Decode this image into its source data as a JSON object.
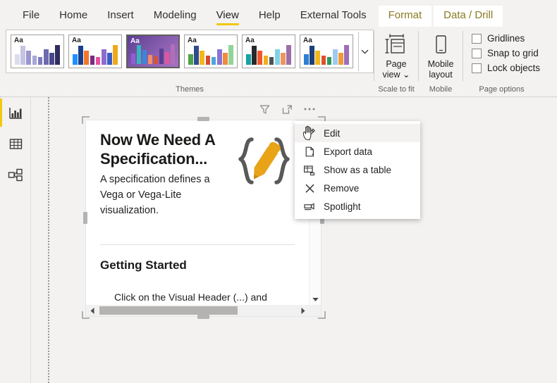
{
  "ribbon": {
    "tabs": [
      {
        "label": "File",
        "active": false,
        "contextual": false
      },
      {
        "label": "Home",
        "active": false,
        "contextual": false
      },
      {
        "label": "Insert",
        "active": false,
        "contextual": false
      },
      {
        "label": "Modeling",
        "active": false,
        "contextual": false
      },
      {
        "label": "View",
        "active": true,
        "contextual": false
      },
      {
        "label": "Help",
        "active": false,
        "contextual": false
      },
      {
        "label": "External Tools",
        "active": false,
        "contextual": false
      },
      {
        "label": "Format",
        "active": false,
        "contextual": true
      },
      {
        "label": "Data / Drill",
        "active": false,
        "contextual": true
      }
    ],
    "active_tab_accent": "#f2c811",
    "contextual_tab_color": "#8a7b20",
    "groups": {
      "themes": {
        "label": "Themes",
        "more_icon": "chevron-down-icon",
        "thumbs": [
          {
            "name": "theme-default",
            "aa": "Aa",
            "selected": false,
            "background": "#ffffff",
            "aa_color": "#201f1e",
            "bars": [
              "#dcdcee",
              "#c6c4e2",
              "#9a97cf",
              "#a9a7d8",
              "#7e7bbd",
              "#6d6ab0",
              "#4a4789",
              "#2f2d5e"
            ]
          },
          {
            "name": "theme-colorful",
            "aa": "Aa",
            "selected": false,
            "background": "#ffffff",
            "aa_color": "#201f1e",
            "bars": [
              "#1e90ff",
              "#1b3f8b",
              "#f4762a",
              "#7a2a86",
              "#e8509a",
              "#8f6bd0",
              "#3a5fc4",
              "#efa81c"
            ]
          },
          {
            "name": "theme-innovate",
            "aa": "Aa",
            "selected": true,
            "background": "linear-gradient(135deg,#5b3f94 0%,#8a5fb0 55%,#a871c2 100%)",
            "aa_color": "#ffffff",
            "bars": [
              "#8f5fd0",
              "#35b5c0",
              "#3a86d8",
              "#f08f6a",
              "#d2543c",
              "#5b3f94",
              "#e0559b",
              "#b06fb8"
            ]
          },
          {
            "name": "theme-bloom",
            "aa": "Aa",
            "selected": false,
            "background": "#ffffff",
            "aa_color": "#201f1e",
            "bars": [
              "#4ea24a",
              "#2f4b8f",
              "#f0b71e",
              "#d44a32",
              "#4fa4e0",
              "#8a73d6",
              "#f08a3c",
              "#92d39a"
            ]
          },
          {
            "name": "theme-tidal",
            "aa": "Aa",
            "selected": false,
            "background": "#ffffff",
            "aa_color": "#201f1e",
            "bars": [
              "#16a3a3",
              "#262a2e",
              "#f0562c",
              "#efb01c",
              "#4d5359",
              "#7fd3e8",
              "#f0955a",
              "#9c6fa8"
            ]
          },
          {
            "name": "theme-executive",
            "aa": "Aa",
            "selected": false,
            "background": "#ffffff",
            "aa_color": "#201f1e",
            "bars": [
              "#2b7fd4",
              "#1c3f7a",
              "#f0b71e",
              "#e0502c",
              "#2d9a5c",
              "#9fc9ef",
              "#f09a3c",
              "#9c6fb8"
            ]
          }
        ]
      },
      "scale_to_fit": {
        "label": "Scale to fit",
        "button": {
          "name": "page-view-button",
          "line1": "Page",
          "line2": "view",
          "icon": "page-view-icon",
          "has_chevron": true
        }
      },
      "mobile": {
        "label": "Mobile",
        "button": {
          "name": "mobile-layout-button",
          "line1": "Mobile",
          "line2": "layout",
          "icon": "phone-icon"
        }
      },
      "page_options": {
        "label": "Page options",
        "checks": [
          {
            "label": "Gridlines",
            "checked": false
          },
          {
            "label": "Snap to grid",
            "checked": false
          },
          {
            "label": "Lock objects",
            "checked": false
          }
        ]
      }
    }
  },
  "sidebar": {
    "items": [
      {
        "name": "report-view",
        "icon": "bar-chart-icon",
        "active": true
      },
      {
        "name": "data-view",
        "icon": "table-icon",
        "active": false
      },
      {
        "name": "model-view",
        "icon": "model-relationships-icon",
        "active": false
      }
    ]
  },
  "visual_header": {
    "icons": [
      {
        "name": "filter-icon",
        "label": "Filters"
      },
      {
        "name": "focus-mode-icon",
        "label": "Focus mode"
      },
      {
        "name": "more-options-icon",
        "label": "More options"
      }
    ]
  },
  "visual": {
    "title": "Now We Need A Specification...",
    "subtitle": "A specification defines a Vega or Vega-Lite visualization.",
    "section_heading": "Getting Started",
    "body": "Click on the Visual Header (...) and choose ‘Edit’ to display the Visual Editor and get creating. You will also",
    "logo": "deneb-pencil-braces-logo",
    "logo_color": "#e8a317",
    "brace_color": "#595959",
    "selected": true
  },
  "context_menu": {
    "items": [
      {
        "label": "Edit",
        "icon": "pencil-icon",
        "highlighted": true
      },
      {
        "label": "Export data",
        "icon": "export-data-icon",
        "highlighted": false
      },
      {
        "label": "Show as a table",
        "icon": "show-as-table-icon",
        "highlighted": false
      },
      {
        "label": "Remove",
        "icon": "close-x-icon",
        "highlighted": false
      },
      {
        "label": "Spotlight",
        "icon": "spotlight-icon",
        "highlighted": false
      }
    ]
  },
  "cursor": {
    "type": "hand-pointer-cursor"
  }
}
